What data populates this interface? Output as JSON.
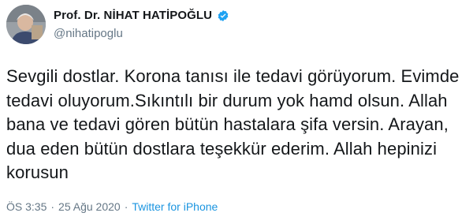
{
  "user": {
    "display_name": "Prof. Dr. NİHAT HATİPOĞLU",
    "handle": "@nihatipoglu",
    "verified_icon": "verified-badge-icon",
    "verified_color": "#1da1f2"
  },
  "tweet": {
    "text": "Sevgili dostlar. Korona tanısı ile tedavi görüyorum. Evimde tedavi oluyorum.Sıkıntılı bir durum yok hamd olsun. Allah bana ve tedavi gören bütün hastalara şifa versin. Arayan, dua eden bütün dostlara teşekkür ederim. Allah hepinizi korusun",
    "time": "ÖS 3:35",
    "separator": "·",
    "date": "25 Ağu 2020",
    "source": "Twitter for iPhone"
  },
  "colors": {
    "text": "#14171a",
    "secondary": "#657786",
    "link": "#1b95e0"
  }
}
